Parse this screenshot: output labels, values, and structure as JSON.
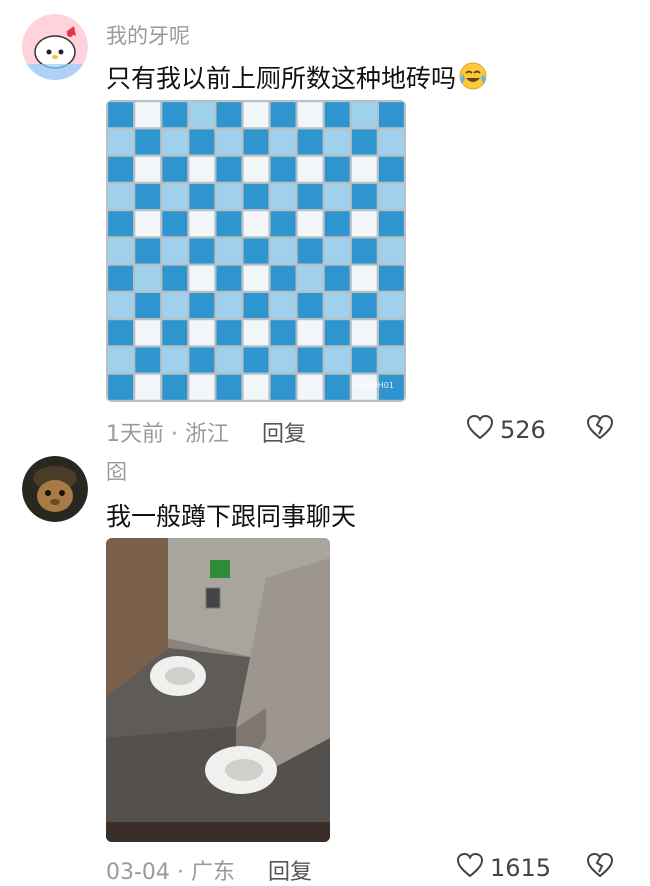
{
  "comments": [
    {
      "username": "我的牙呢",
      "text": "只有我以前上厕所数这种地砖吗",
      "emoji_icon": "crying-laughing-emoji",
      "time": "1天前",
      "separator": "·",
      "location": "浙江",
      "reply_label": "回复",
      "like_count": "526",
      "image_watermark": "94680H01"
    },
    {
      "username": "囵",
      "text": "我一般蹲下跟同事聊天",
      "time": "03-04",
      "separator": "·",
      "location": "广东",
      "reply_label": "回复",
      "like_count": "1615"
    }
  ],
  "colors": {
    "tile_dark": "#2f95cf",
    "tile_light": "#9fd0ec",
    "tile_white": "#f3f6f8",
    "grout": "#b8c0c6"
  }
}
